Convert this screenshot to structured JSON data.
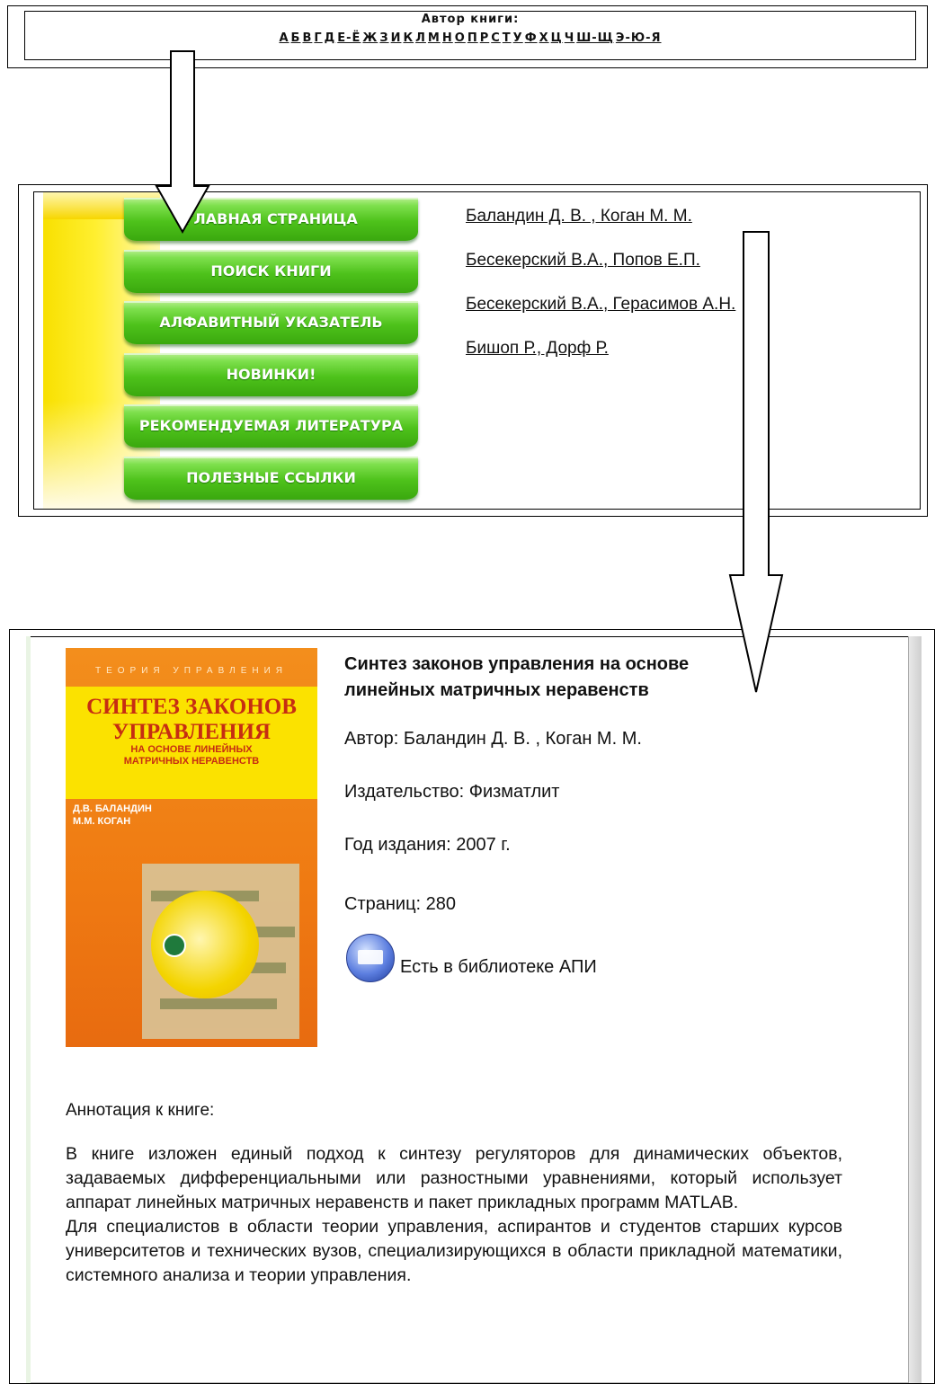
{
  "alphabet": {
    "title": "Автор книги:",
    "letters": [
      "А",
      "Б",
      "В",
      "Г",
      "Д",
      "Е-Ё",
      "Ж",
      "З",
      "И",
      "К",
      "Л",
      "М",
      "Н",
      "О",
      "П",
      "Р",
      "С",
      "Т",
      "У",
      "Ф",
      "Х",
      "Ц",
      "Ч",
      "Ш-Щ",
      "Э-Ю-Я"
    ]
  },
  "menu": {
    "items": [
      "ГЛАВНАЯ СТРАНИЦА",
      "ПОИСК КНИГИ",
      "АЛФАВИТНЫЙ УКАЗАТЕЛЬ",
      "НОВИНКИ!",
      "РЕКОМЕНДУЕМАЯ ЛИТЕРАТУРА",
      "ПОЛЕЗНЫЕ ССЫЛКИ"
    ]
  },
  "authors": [
    "Баландин Д. В. , Коган М. М.",
    "Бесекерский В.А., Попов Е.П.",
    "Бесекерский В.А., Герасимов А.Н.",
    "Бишоп Р., Дорф Р."
  ],
  "book": {
    "cover": {
      "series": "ТЕОРИЯ УПРАВЛЕНИЯ",
      "title_line1": "СИНТЕЗ ЗАКОНОВ",
      "title_line2": "УПРАВЛЕНИЯ",
      "subtitle_line1": "НА ОСНОВЕ ЛИНЕЙНЫХ",
      "subtitle_line2": "МАТРИЧНЫХ НЕРАВЕНСТВ",
      "author1": "Д.В. БАЛАНДИН",
      "author2": "М.М. КОГАН"
    },
    "title": "Синтез законов управления на основе линейных матричных неравенств",
    "author": "Автор: Баландин Д. В. , Коган М. М.",
    "publisher": "Издательство: Физматлит",
    "year": "Год издания: 2007 г.",
    "pages": "Страниц: 280",
    "availability": "Есть в библиотеке АПИ",
    "annotation_label": "Аннотация к книге:",
    "annotation_p1": "В книге изложен единый подход к синтезу регуляторов для динамических объектов, задаваемых дифференциальными или разностными уравнениями, который использует аппарат линейных матричных неравенств и пакет прикладных программ MATLAB.",
    "annotation_p2": "Для специалистов в области теории управления, аспирантов и студентов старших курсов университетов и технических вузов, специализирующихся в области прикладной математики, системного анализа и теории управления."
  },
  "colors": {
    "menu_green": "#4ec21b",
    "strip_yellow": "#f8e000",
    "cover_orange": "#ef7a12"
  }
}
